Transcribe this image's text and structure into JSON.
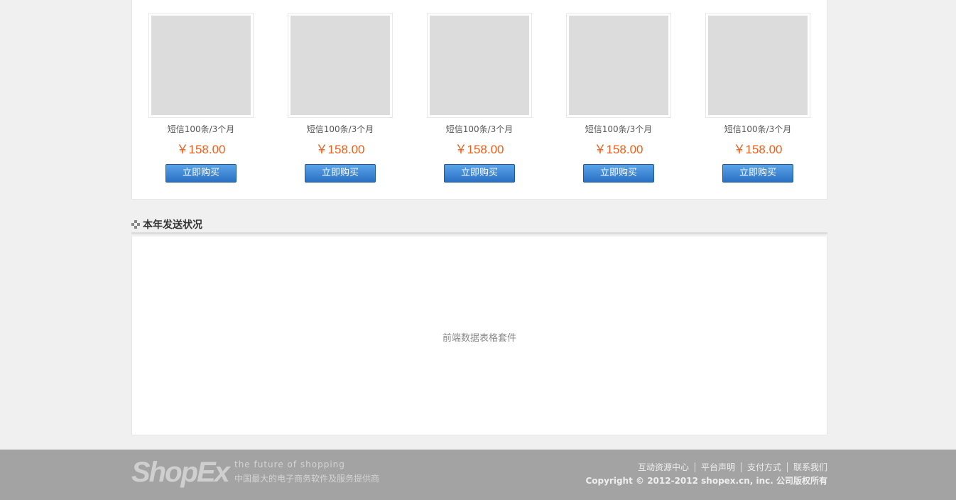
{
  "products": [
    {
      "name": "短信100条/3个月",
      "price": "￥158.00",
      "button": "立即购买"
    },
    {
      "name": "短信100条/3个月",
      "price": "￥158.00",
      "button": "立即购买"
    },
    {
      "name": "短信100条/3个月",
      "price": "￥158.00",
      "button": "立即购买"
    },
    {
      "name": "短信100条/3个月",
      "price": "￥158.00",
      "button": "立即购买"
    },
    {
      "name": "短信100条/3个月",
      "price": "￥158.00",
      "button": "立即购买"
    }
  ],
  "section": {
    "title": "本年发送状况",
    "chart_placeholder": "前端数据表格套件"
  },
  "footer": {
    "logo": "ShopEx",
    "tagline": "the future of shopping",
    "slogan": "中国最大的电子商务软件及服务提供商",
    "links": [
      "互动资源中心",
      "平台声明",
      "支付方式",
      "联系我们"
    ],
    "copyright": "Copyright © 2012-2012 shopex.cn, inc. 公司版权所有"
  },
  "colors": {
    "price": "#f25d18",
    "button": "#2a70c4",
    "footer_bg": "#a3a3a3"
  }
}
